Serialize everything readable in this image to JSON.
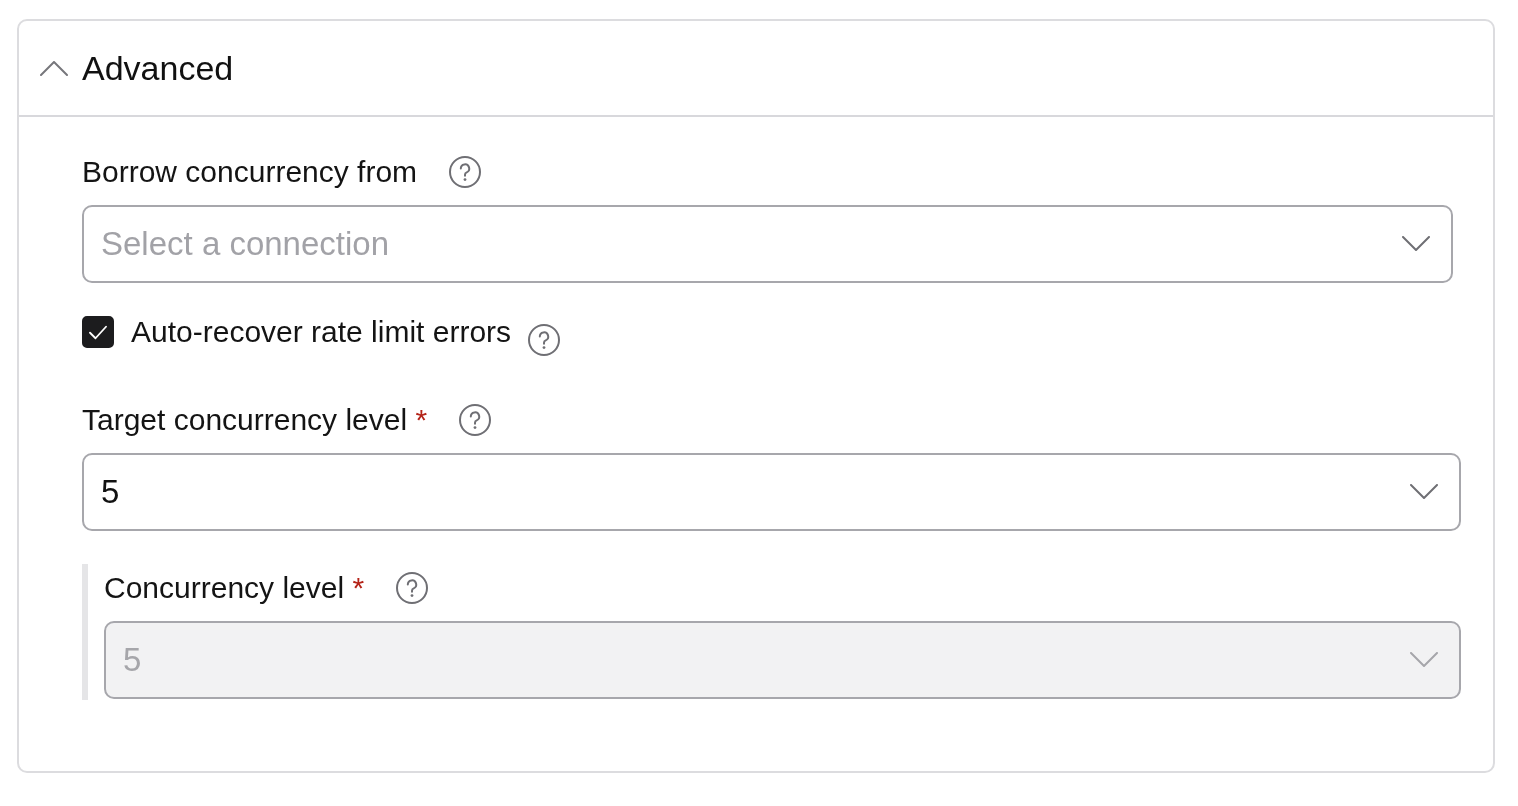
{
  "panel": {
    "title": "Advanced",
    "expanded": true
  },
  "fields": [
    {
      "kind": "select",
      "label": "Borrow concurrency from",
      "placeholder": "Select a connection",
      "disabled": false
    },
    {
      "kind": "checkbox",
      "label": "Auto-recover rate limit errors",
      "checked": true
    },
    {
      "kind": "select",
      "label": "Target concurrency level",
      "required_mark": "*",
      "value": "5",
      "disabled": false,
      "children": [
        {
          "kind": "select",
          "label": "Concurrency level",
          "required_mark": "*",
          "value": "5",
          "disabled": true
        }
      ]
    }
  ]
}
